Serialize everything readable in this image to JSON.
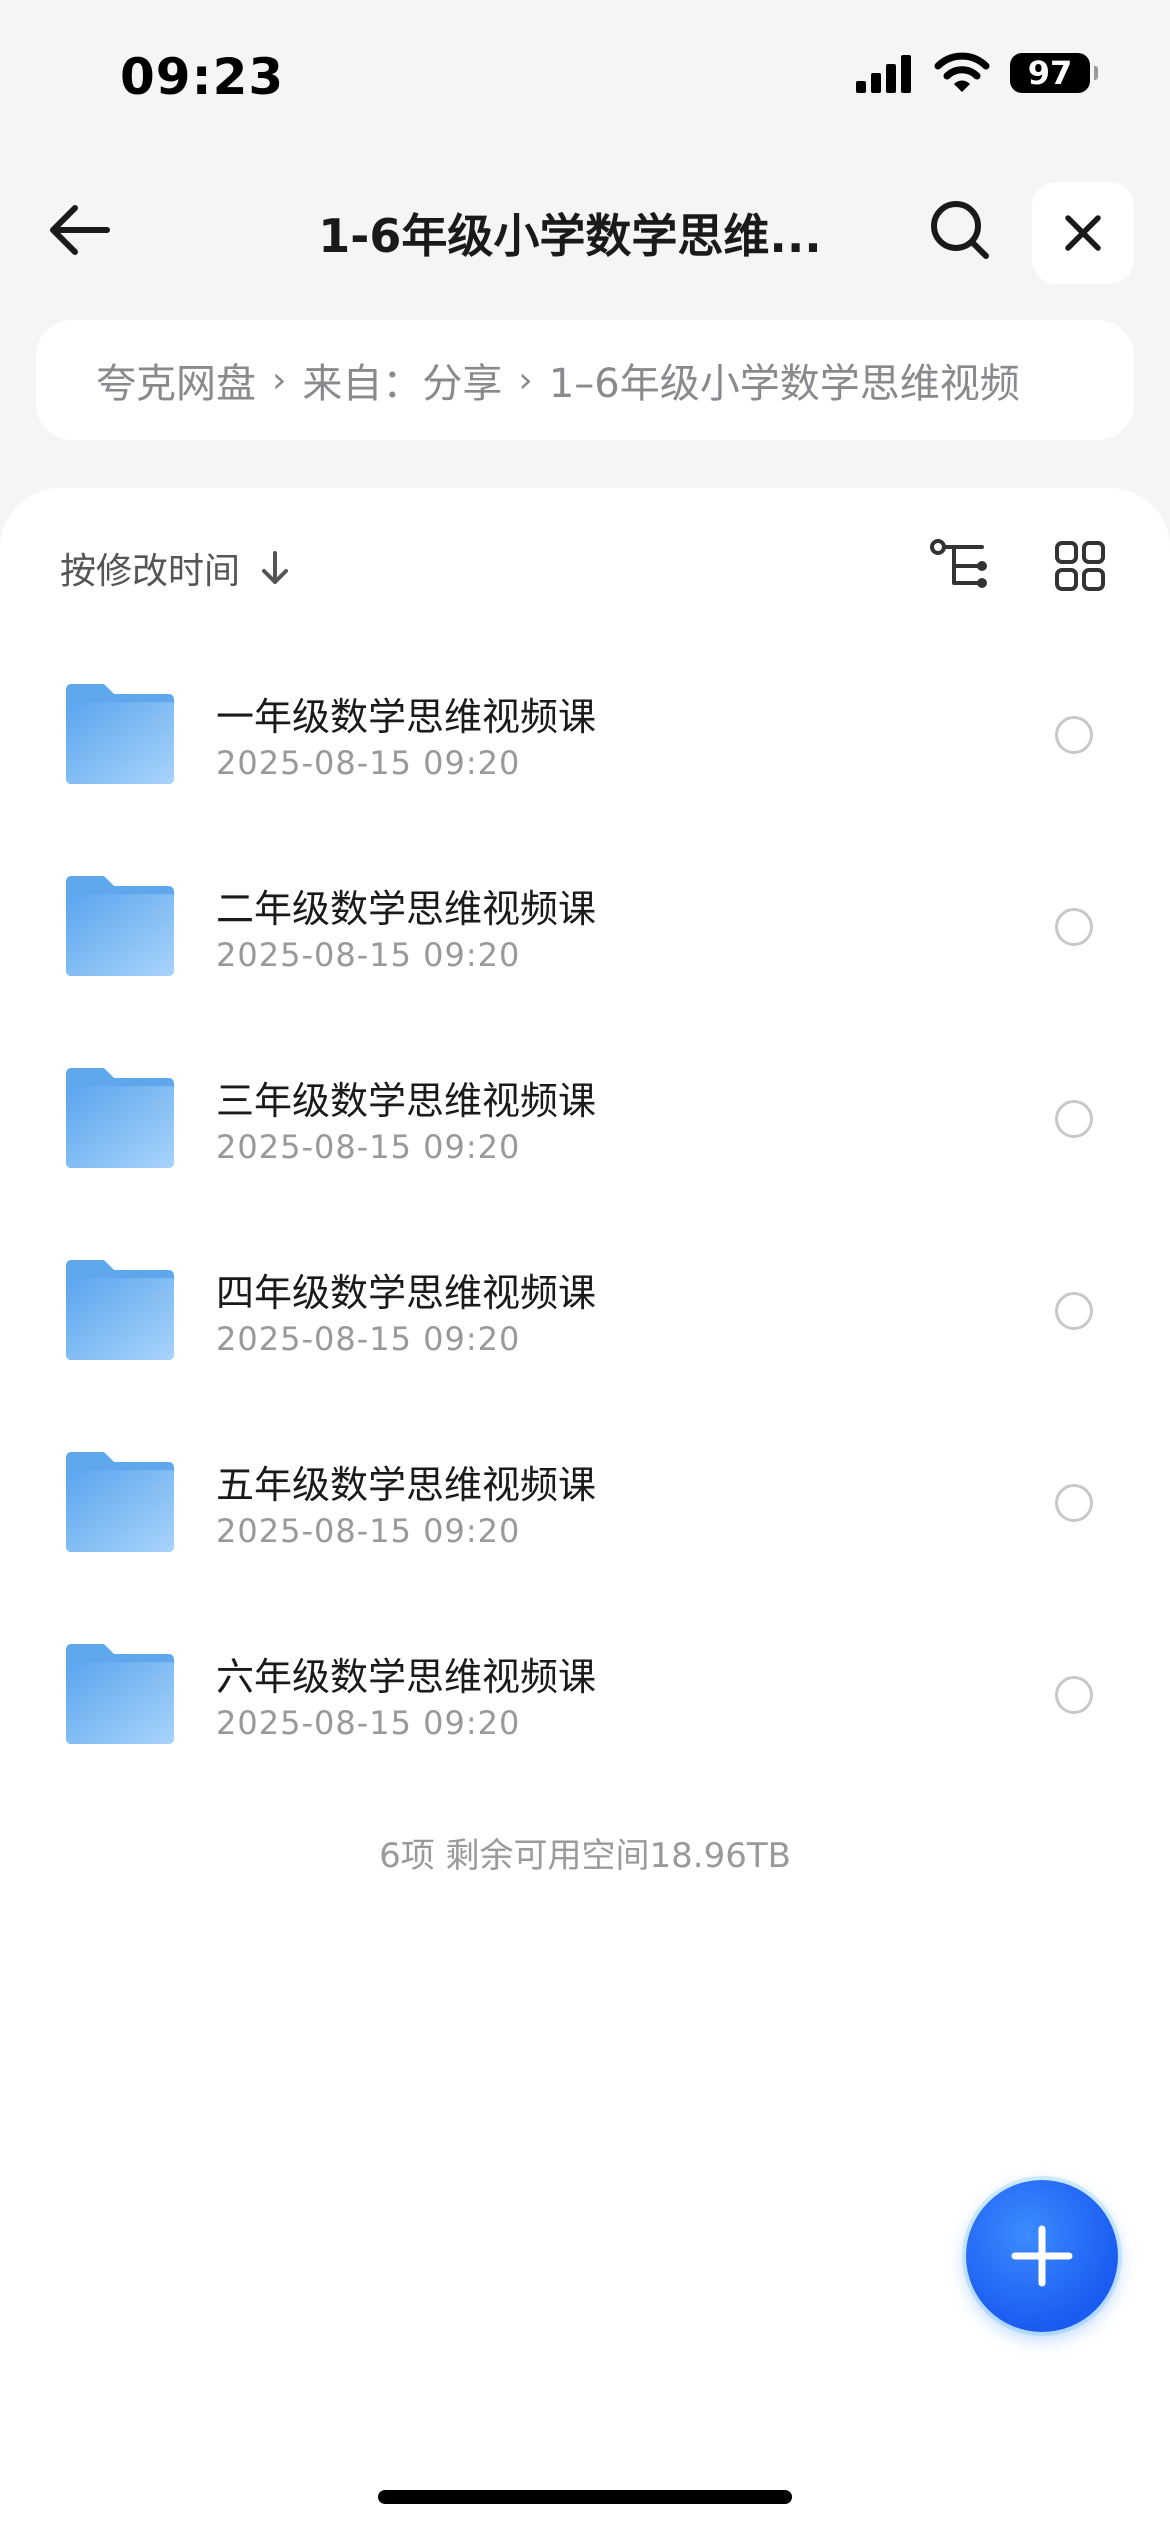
{
  "status": {
    "time": "09:23",
    "battery": "97"
  },
  "nav": {
    "title": "1-6年级小学数学思维..."
  },
  "breadcrumb": {
    "items": [
      "夸克网盘",
      "来自：分享",
      "1–6年级小学数学思维视频"
    ],
    "separator": "›"
  },
  "toolbar": {
    "sort_label": "按修改时间"
  },
  "files": [
    {
      "name": "一年级数学思维视频课",
      "date": "2025-08-15 09:20"
    },
    {
      "name": "二年级数学思维视频课",
      "date": "2025-08-15 09:20"
    },
    {
      "name": "三年级数学思维视频课",
      "date": "2025-08-15 09:20"
    },
    {
      "name": "四年级数学思维视频课",
      "date": "2025-08-15 09:20"
    },
    {
      "name": "五年级数学思维视频课",
      "date": "2025-08-15 09:20"
    },
    {
      "name": "六年级数学思维视频课",
      "date": "2025-08-15 09:20"
    }
  ],
  "footer": {
    "summary": "6项 剩余可用空间18.96TB"
  },
  "icons": {
    "back": "arrow-left-icon",
    "search": "search-icon",
    "close": "close-icon",
    "tree": "tree-view-icon",
    "grid": "grid-view-icon",
    "folder": "folder-icon",
    "add": "plus-icon"
  },
  "colors": {
    "accent": "#1a5cf0",
    "folder": "#6fb2f3",
    "background": "#f5f5f7"
  }
}
